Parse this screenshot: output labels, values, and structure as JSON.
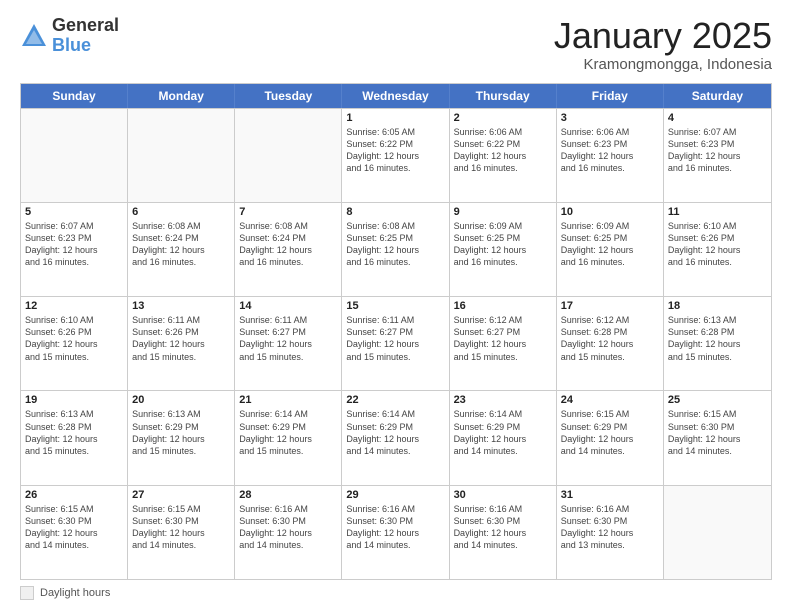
{
  "logo": {
    "general": "General",
    "blue": "Blue"
  },
  "title": {
    "month": "January 2025",
    "location": "Kramongmongga, Indonesia"
  },
  "header_days": [
    "Sunday",
    "Monday",
    "Tuesday",
    "Wednesday",
    "Thursday",
    "Friday",
    "Saturday"
  ],
  "rows": [
    [
      {
        "day": "",
        "info": "",
        "empty": true
      },
      {
        "day": "",
        "info": "",
        "empty": true
      },
      {
        "day": "",
        "info": "",
        "empty": true
      },
      {
        "day": "1",
        "info": "Sunrise: 6:05 AM\nSunset: 6:22 PM\nDaylight: 12 hours\nand 16 minutes."
      },
      {
        "day": "2",
        "info": "Sunrise: 6:06 AM\nSunset: 6:22 PM\nDaylight: 12 hours\nand 16 minutes."
      },
      {
        "day": "3",
        "info": "Sunrise: 6:06 AM\nSunset: 6:23 PM\nDaylight: 12 hours\nand 16 minutes."
      },
      {
        "day": "4",
        "info": "Sunrise: 6:07 AM\nSunset: 6:23 PM\nDaylight: 12 hours\nand 16 minutes."
      }
    ],
    [
      {
        "day": "5",
        "info": "Sunrise: 6:07 AM\nSunset: 6:23 PM\nDaylight: 12 hours\nand 16 minutes."
      },
      {
        "day": "6",
        "info": "Sunrise: 6:08 AM\nSunset: 6:24 PM\nDaylight: 12 hours\nand 16 minutes."
      },
      {
        "day": "7",
        "info": "Sunrise: 6:08 AM\nSunset: 6:24 PM\nDaylight: 12 hours\nand 16 minutes."
      },
      {
        "day": "8",
        "info": "Sunrise: 6:08 AM\nSunset: 6:25 PM\nDaylight: 12 hours\nand 16 minutes."
      },
      {
        "day": "9",
        "info": "Sunrise: 6:09 AM\nSunset: 6:25 PM\nDaylight: 12 hours\nand 16 minutes."
      },
      {
        "day": "10",
        "info": "Sunrise: 6:09 AM\nSunset: 6:25 PM\nDaylight: 12 hours\nand 16 minutes."
      },
      {
        "day": "11",
        "info": "Sunrise: 6:10 AM\nSunset: 6:26 PM\nDaylight: 12 hours\nand 16 minutes."
      }
    ],
    [
      {
        "day": "12",
        "info": "Sunrise: 6:10 AM\nSunset: 6:26 PM\nDaylight: 12 hours\nand 15 minutes."
      },
      {
        "day": "13",
        "info": "Sunrise: 6:11 AM\nSunset: 6:26 PM\nDaylight: 12 hours\nand 15 minutes."
      },
      {
        "day": "14",
        "info": "Sunrise: 6:11 AM\nSunset: 6:27 PM\nDaylight: 12 hours\nand 15 minutes."
      },
      {
        "day": "15",
        "info": "Sunrise: 6:11 AM\nSunset: 6:27 PM\nDaylight: 12 hours\nand 15 minutes."
      },
      {
        "day": "16",
        "info": "Sunrise: 6:12 AM\nSunset: 6:27 PM\nDaylight: 12 hours\nand 15 minutes."
      },
      {
        "day": "17",
        "info": "Sunrise: 6:12 AM\nSunset: 6:28 PM\nDaylight: 12 hours\nand 15 minutes."
      },
      {
        "day": "18",
        "info": "Sunrise: 6:13 AM\nSunset: 6:28 PM\nDaylight: 12 hours\nand 15 minutes."
      }
    ],
    [
      {
        "day": "19",
        "info": "Sunrise: 6:13 AM\nSunset: 6:28 PM\nDaylight: 12 hours\nand 15 minutes."
      },
      {
        "day": "20",
        "info": "Sunrise: 6:13 AM\nSunset: 6:29 PM\nDaylight: 12 hours\nand 15 minutes."
      },
      {
        "day": "21",
        "info": "Sunrise: 6:14 AM\nSunset: 6:29 PM\nDaylight: 12 hours\nand 15 minutes."
      },
      {
        "day": "22",
        "info": "Sunrise: 6:14 AM\nSunset: 6:29 PM\nDaylight: 12 hours\nand 14 minutes."
      },
      {
        "day": "23",
        "info": "Sunrise: 6:14 AM\nSunset: 6:29 PM\nDaylight: 12 hours\nand 14 minutes."
      },
      {
        "day": "24",
        "info": "Sunrise: 6:15 AM\nSunset: 6:29 PM\nDaylight: 12 hours\nand 14 minutes."
      },
      {
        "day": "25",
        "info": "Sunrise: 6:15 AM\nSunset: 6:30 PM\nDaylight: 12 hours\nand 14 minutes."
      }
    ],
    [
      {
        "day": "26",
        "info": "Sunrise: 6:15 AM\nSunset: 6:30 PM\nDaylight: 12 hours\nand 14 minutes."
      },
      {
        "day": "27",
        "info": "Sunrise: 6:15 AM\nSunset: 6:30 PM\nDaylight: 12 hours\nand 14 minutes."
      },
      {
        "day": "28",
        "info": "Sunrise: 6:16 AM\nSunset: 6:30 PM\nDaylight: 12 hours\nand 14 minutes."
      },
      {
        "day": "29",
        "info": "Sunrise: 6:16 AM\nSunset: 6:30 PM\nDaylight: 12 hours\nand 14 minutes."
      },
      {
        "day": "30",
        "info": "Sunrise: 6:16 AM\nSunset: 6:30 PM\nDaylight: 12 hours\nand 14 minutes."
      },
      {
        "day": "31",
        "info": "Sunrise: 6:16 AM\nSunset: 6:30 PM\nDaylight: 12 hours\nand 13 minutes."
      },
      {
        "day": "",
        "info": "",
        "empty": true
      }
    ]
  ],
  "footer": {
    "box_label": "Daylight hours"
  }
}
